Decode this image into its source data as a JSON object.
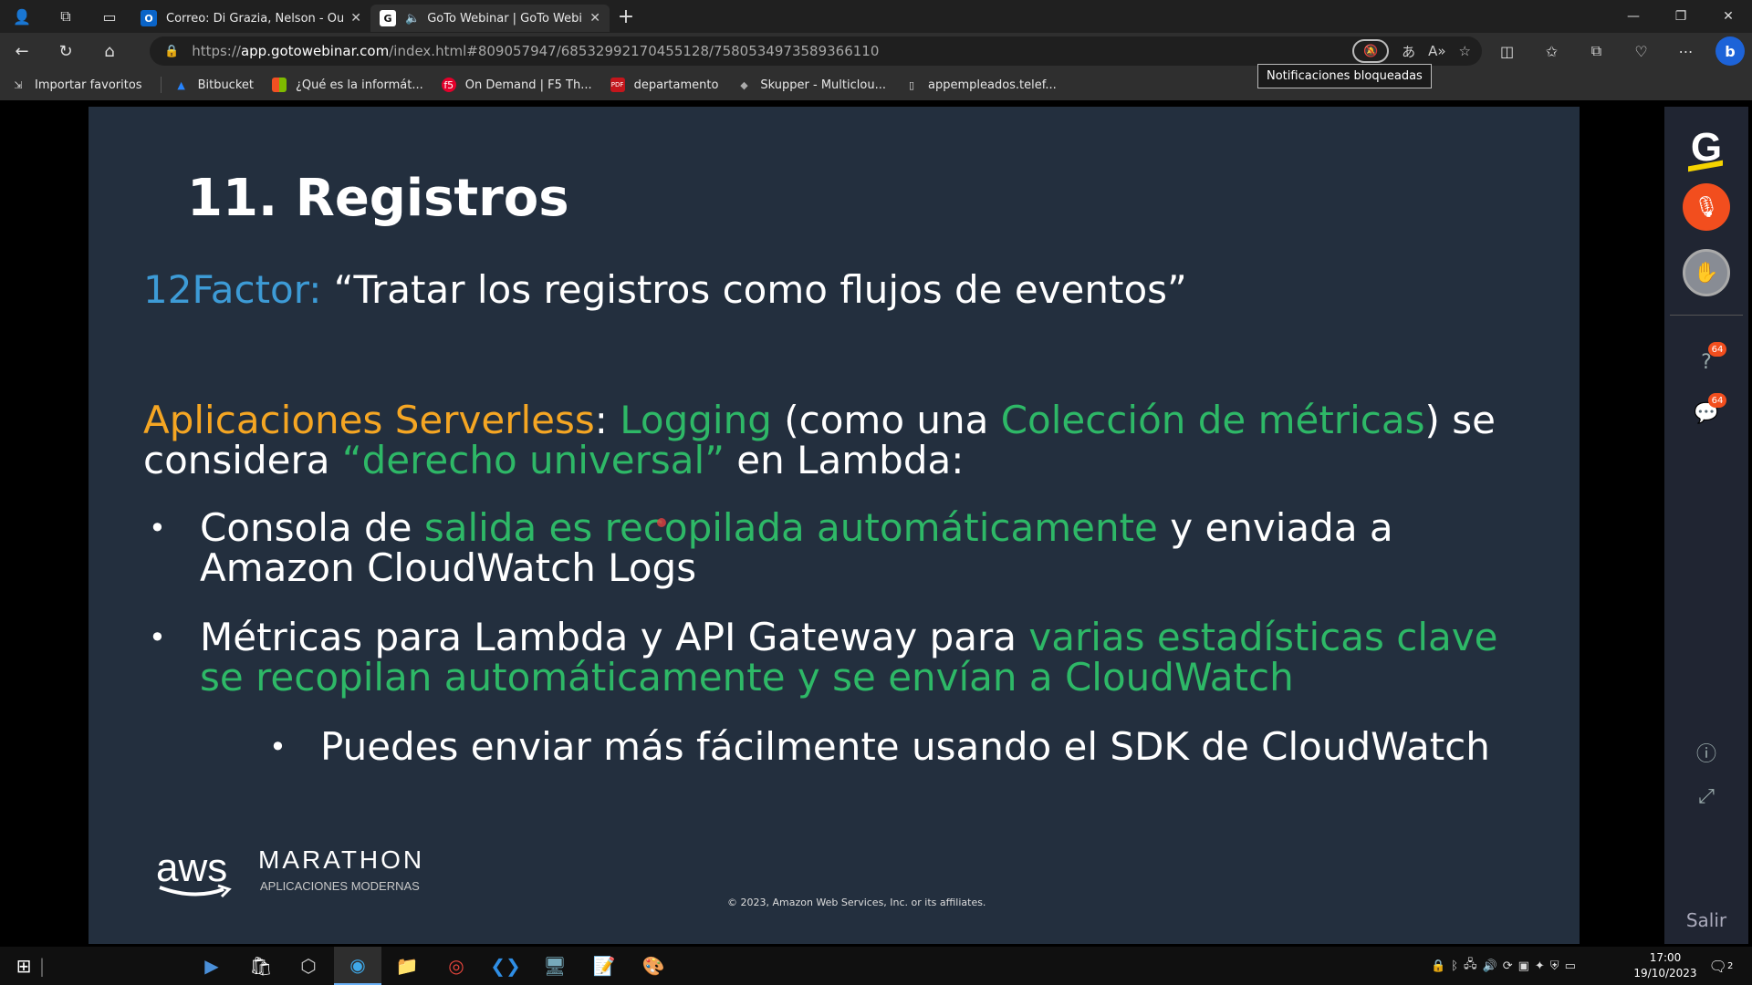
{
  "browser": {
    "tabs": [
      {
        "title": "Correo: Di Grazia, Nelson - Outlo",
        "favicon": "O"
      },
      {
        "title": "GoTo Webinar | GoTo Webin",
        "favicon": "G"
      }
    ],
    "new_tab": "+",
    "url_domain": "app.gotowebinar.com",
    "url_prefix": "https://",
    "url_path": "/index.html#809057947/6853299217045512​8/7580534973589366110",
    "tooltip": "Notificaciones bloqueadas",
    "bookmarks": [
      {
        "label": "Importar favoritos"
      },
      {
        "label": "Bitbucket"
      },
      {
        "label": "¿Qué es la informát..."
      },
      {
        "label": "On Demand | F5 Th..."
      },
      {
        "label": "departamento"
      },
      {
        "label": "Skupper - Multiclou..."
      },
      {
        "label": "appempleados.telef..."
      }
    ]
  },
  "slide": {
    "title": "11. Registros",
    "factor_label": "12Factor:",
    "factor_quote": " “Tratar los registros como flujos de eventos”",
    "para": {
      "p1": "Aplicaciones Serverless",
      "p2": ": ",
      "p3": "Logging",
      "p4": " (como una ",
      "p5": "Colección de métricas",
      "p6": ") se considera ",
      "p7": "“derecho universal”",
      "p8": " en Lambda:"
    },
    "bullet1": {
      "a": "Consola de ",
      "b": "salida es recopilada automáticamente",
      "c": " y enviada a Amazon CloudWatch Logs"
    },
    "bullet2": {
      "a": "Métricas para Lambda y API Gateway para ",
      "b": "varias estadísticas clave se recopilan automáticamente y se envían a CloudWatch"
    },
    "bullet3": "Puedes enviar más fácilmente usando el SDK de CloudWatch",
    "aws": "aws",
    "marathon": "MARATHON",
    "marathon_sub": "APLICACIONES MODERNAS",
    "copyright": "© 2023, Amazon Web Services, Inc. or its affiliates."
  },
  "side_panel": {
    "logo": "G",
    "questions_badge": "64",
    "chat_badge": "64",
    "exit": "Salir"
  },
  "taskbar": {
    "time": "17:00",
    "date": "19/10/2023",
    "notifications": "2"
  },
  "colors": {
    "accent_orange": "#f5a623",
    "accent_green": "#2eb867",
    "accent_blue": "#3d9bd6",
    "slide_bg": "#232f3e"
  }
}
